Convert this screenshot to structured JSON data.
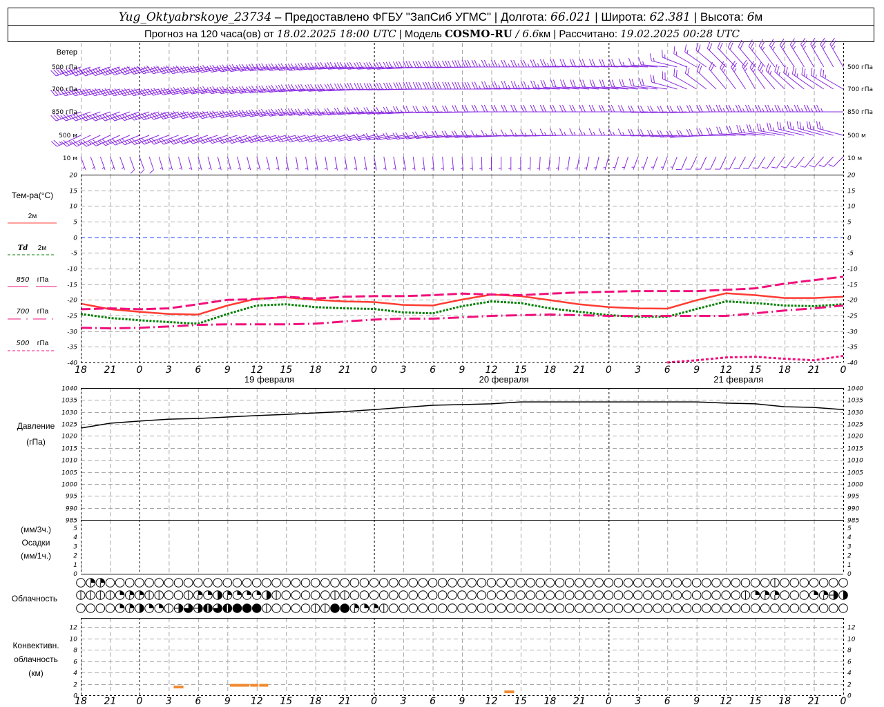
{
  "header": {
    "station": "Yug_Oktyabrskoye_23734",
    "provided": " – Предоставлено ФГБУ \"ЗапСиб УГМС\" | Долгота: ",
    "lon": "66.021",
    "lat_label": " | Широта: ",
    "lat": "62.381",
    "alt_label": " | Высота: ",
    "alt": "6",
    "alt_unit": "м",
    "forecast_label": "Прогноз на 120 часа(ов) от ",
    "forecast_time": "18.02.2025 18:00 UTC",
    "model_label": " | Модель ",
    "model": "COSMO-RU",
    "resolution": " / 6.6",
    "res_unit": "км",
    "calc_label": " | Рассчитано: ",
    "calc_time": "19.02.2025 00:28 UTC"
  },
  "labels": {
    "wind": "Ветер",
    "temp": "Тем-ра(°С)",
    "t2m": "2м",
    "td": "Td",
    "td2m": "2м",
    "l850": "850",
    "l700": "700",
    "l500": "500",
    "hpa": "гПа",
    "pressure": "Давление",
    "pressure_unit": "(гПа)",
    "precip3": "(мм/3ч.)",
    "precip": "Осадки",
    "precip1": "(мм/1ч.)",
    "clouds": "Облачность",
    "conv1": "Конвективн.",
    "conv2": "облачность",
    "conv3": "(км)"
  },
  "chart_data": {
    "type": "meteogram",
    "colors": {
      "wind": "#8a2be2",
      "t2m": "#ff3c32",
      "td2m": "#008000",
      "upper": "#f0107c",
      "zero_line": "#2040ff",
      "pressure": "#000000",
      "convective": "#f08a30"
    },
    "time_axis": {
      "times": [
        "18.02 18:00",
        "18.02 21:00",
        "19.02 00:00",
        "19.02 03:00",
        "19.02 06:00",
        "19.02 09:00",
        "19.02 12:00",
        "19.02 15:00",
        "19.02 18:00",
        "19.02 21:00",
        "20.02 00:00",
        "20.02 03:00",
        "20.02 06:00",
        "20.02 09:00",
        "20.02 12:00",
        "20.02 15:00",
        "20.02 18:00",
        "20.02 21:00",
        "21.02 00:00",
        "21.02 03:00",
        "21.02 06:00",
        "21.02 09:00",
        "21.02 12:00",
        "21.02 15:00",
        "21.02 18:00",
        "21.02 21:00",
        "22.02 00:00"
      ],
      "tick_labels": [
        "18",
        "21",
        "0",
        "3",
        "6",
        "9",
        "12",
        "15",
        "18",
        "21",
        "0",
        "3",
        "6",
        "9",
        "12",
        "15",
        "18",
        "21",
        "0",
        "3",
        "6",
        "9",
        "12",
        "15",
        "18",
        "21",
        "0"
      ],
      "day_labels": [
        "19 февраля",
        "20 февраля",
        "21 февраля"
      ]
    },
    "wind": {
      "levels": [
        {
          "label": "500 гПа",
          "dir": [
            250,
            250,
            252,
            255,
            255,
            258,
            260,
            262,
            262,
            265,
            265,
            265,
            268,
            268,
            270,
            270,
            270,
            272,
            272,
            272,
            275,
            300,
            315,
            320,
            325,
            330,
            330
          ],
          "speed": [
            40,
            40,
            40,
            38,
            38,
            36,
            36,
            35,
            35,
            35,
            32,
            30,
            30,
            28,
            28,
            25,
            25,
            22,
            20,
            18,
            15,
            15,
            20,
            22,
            25,
            25,
            25
          ]
        },
        {
          "label": "700 гПа",
          "dir": [
            255,
            255,
            255,
            255,
            258,
            260,
            260,
            262,
            265,
            265,
            268,
            268,
            270,
            270,
            270,
            272,
            272,
            275,
            275,
            275,
            278,
            300,
            320,
            330,
            315,
            305,
            300
          ],
          "speed": [
            35,
            35,
            35,
            35,
            32,
            32,
            30,
            30,
            30,
            28,
            28,
            28,
            30,
            30,
            28,
            25,
            25,
            20,
            18,
            18,
            20,
            20,
            22,
            25,
            25,
            25,
            25
          ]
        },
        {
          "label": "850 гПа",
          "dir": [
            250,
            250,
            250,
            252,
            255,
            255,
            258,
            260,
            262,
            262,
            265,
            265,
            268,
            268,
            270,
            270,
            270,
            270,
            270,
            270,
            268,
            268,
            270,
            270,
            270,
            270,
            270
          ],
          "speed": [
            30,
            30,
            30,
            30,
            30,
            28,
            28,
            28,
            28,
            25,
            25,
            25,
            22,
            22,
            20,
            20,
            18,
            18,
            18,
            20,
            20,
            20,
            22,
            25,
            25,
            25,
            25
          ]
        },
        {
          "label": "500 м",
          "dir": [
            245,
            245,
            248,
            250,
            250,
            252,
            252,
            255,
            255,
            255,
            258,
            260,
            262,
            265,
            265,
            268,
            268,
            270,
            270,
            270,
            268,
            265,
            270,
            275,
            280,
            285,
            285
          ],
          "speed": [
            25,
            25,
            25,
            25,
            25,
            25,
            25,
            22,
            22,
            22,
            20,
            20,
            18,
            18,
            18,
            15,
            15,
            15,
            15,
            15,
            20,
            20,
            20,
            22,
            25,
            25,
            25
          ]
        },
        {
          "label": "10 м",
          "dir": [
            160,
            160,
            160,
            165,
            165,
            165,
            165,
            170,
            170,
            170,
            170,
            170,
            175,
            175,
            180,
            180,
            185,
            190,
            195,
            200,
            200,
            205,
            205,
            210,
            215,
            220,
            225
          ],
          "speed": [
            5,
            5,
            10,
            5,
            5,
            5,
            5,
            5,
            5,
            5,
            5,
            5,
            5,
            5,
            5,
            5,
            5,
            5,
            5,
            5,
            5,
            10,
            10,
            10,
            10,
            10,
            10
          ]
        }
      ]
    },
    "temperature": {
      "ylim": [
        -40,
        20
      ],
      "yticks": [
        20,
        15,
        10,
        5,
        0,
        -5,
        -10,
        -15,
        -20,
        -25,
        -30,
        -35,
        -40
      ],
      "series": [
        {
          "name": "2м",
          "key": "t2m",
          "style": "solid",
          "values": [
            -21.2,
            -23,
            -23.8,
            -24.5,
            -24.7,
            -21.8,
            -19.6,
            -19.2,
            -20,
            -20.5,
            -20.7,
            -21.6,
            -21.8,
            -19.9,
            -18.3,
            -18.8,
            -20.1,
            -21.4,
            -22.3,
            -22.7,
            -22.8,
            -20.1,
            -17.9,
            -18.5,
            -19.4,
            -19.4,
            -19
          ]
        },
        {
          "name": "Td 2м",
          "key": "td2m",
          "style": "dotted",
          "values": [
            -24.5,
            -25.8,
            -26.5,
            -27.1,
            -27.6,
            -24.5,
            -21.8,
            -21.4,
            -22.3,
            -22.7,
            -22.9,
            -24,
            -24.3,
            -22,
            -20.5,
            -21,
            -22.7,
            -23.8,
            -24.9,
            -25.4,
            -25.4,
            -22.9,
            -20.5,
            -21,
            -21.8,
            -22,
            -21.4
          ]
        },
        {
          "name": "850 гПа",
          "key": "upper",
          "style": "longdash",
          "values": [
            -23,
            -22.7,
            -23,
            -22.7,
            -21.4,
            -20,
            -19.8,
            -19,
            -19.6,
            -19,
            -18.8,
            -18.8,
            -18.5,
            -18,
            -18.3,
            -18.5,
            -18,
            -17.6,
            -17.4,
            -17.2,
            -17.2,
            -17.2,
            -16.8,
            -16.3,
            -14.8,
            -13.7,
            -12.6
          ]
        },
        {
          "name": "700 гПа",
          "key": "upper",
          "style": "dashdot",
          "values": [
            -28.9,
            -29.1,
            -28.9,
            -28.5,
            -28,
            -27.8,
            -27.8,
            -27.8,
            -27.6,
            -26.9,
            -26.3,
            -26,
            -26,
            -25.6,
            -25.1,
            -24.9,
            -24.7,
            -24.9,
            -25.1,
            -25.1,
            -25.1,
            -25.1,
            -25.1,
            -24.3,
            -23.4,
            -22.7,
            -21.8
          ]
        },
        {
          "name": "500 гПа",
          "key": "upper",
          "style": "shortdash",
          "values": [
            null,
            null,
            null,
            null,
            null,
            null,
            null,
            null,
            null,
            null,
            null,
            null,
            null,
            null,
            null,
            null,
            null,
            null,
            null,
            null,
            -40,
            -39.3,
            -38.4,
            -38.2,
            -38.8,
            -39.3,
            -37.9
          ]
        }
      ]
    },
    "pressure": {
      "ylim": [
        985,
        1040
      ],
      "yticks": [
        1040,
        1035,
        1030,
        1025,
        1020,
        1015,
        1010,
        1005,
        1000,
        995,
        990,
        985
      ],
      "values": [
        1023.3,
        1025.3,
        1026.2,
        1027,
        1027.3,
        1027.9,
        1028.5,
        1029,
        1029.6,
        1030.2,
        1031,
        1031.9,
        1032.8,
        1033.1,
        1033.4,
        1034.2,
        1034.2,
        1034.2,
        1034.2,
        1034.2,
        1034.2,
        1034.2,
        1033.7,
        1033.4,
        1032.2,
        1031.9,
        1031
      ]
    },
    "precipitation": {
      "ylim": [
        0,
        5
      ],
      "yticks": [
        5,
        4,
        3,
        2,
        1,
        0
      ],
      "values": [
        0,
        0,
        0,
        0,
        0,
        0,
        0,
        0,
        0,
        0,
        0,
        0,
        0,
        0,
        0,
        0,
        0,
        0,
        0,
        0,
        0,
        0,
        0,
        0,
        0,
        0,
        0
      ]
    },
    "cloudiness": {
      "legend": "0 clear, 1 line, 2 quarter, 3 quarter+line, 4 half, 5 half+line, 6 three-quarter, 7 nearly full, 8 full",
      "rows": [
        [
          0,
          3,
          3,
          0,
          0,
          0,
          0,
          0,
          0,
          0,
          0,
          0,
          0,
          0,
          0,
          0,
          0,
          0,
          0,
          0,
          0,
          0,
          0,
          0,
          0,
          0,
          0,
          0,
          0,
          0,
          0,
          0,
          0,
          0,
          0,
          0,
          0,
          0,
          0,
          0,
          0,
          0,
          0,
          0,
          0,
          0,
          0,
          0,
          0,
          0,
          0,
          0,
          0,
          0,
          0,
          0,
          0,
          0,
          0,
          0,
          0,
          0,
          0,
          0,
          0,
          0,
          0,
          0,
          0,
          0,
          0,
          1,
          0,
          0,
          0,
          0,
          0,
          0,
          0
        ],
        [
          1,
          1,
          1,
          1,
          2,
          3,
          3,
          1,
          1,
          0,
          0,
          1,
          3,
          2,
          4,
          3,
          2,
          2,
          2,
          4,
          1,
          0,
          0,
          0,
          0,
          0,
          1,
          1,
          0,
          0,
          0,
          0,
          0,
          0,
          0,
          0,
          0,
          0,
          0,
          0,
          0,
          0,
          0,
          0,
          0,
          0,
          0,
          0,
          0,
          0,
          0,
          0,
          0,
          0,
          0,
          0,
          0,
          0,
          0,
          0,
          0,
          0,
          0,
          0,
          0,
          0,
          0,
          0,
          1,
          2,
          3,
          3,
          0,
          0,
          0,
          2,
          3,
          5,
          4
        ],
        [
          0,
          0,
          0,
          0,
          2,
          3,
          4,
          2,
          2,
          1,
          5,
          6,
          5,
          7,
          6,
          7,
          8,
          8,
          8,
          1,
          0,
          0,
          0,
          0,
          1,
          1,
          8,
          8,
          3,
          2,
          3,
          1,
          0,
          0,
          0,
          0,
          0,
          0,
          0,
          0,
          0,
          0,
          0,
          0,
          0,
          0,
          0,
          0,
          0,
          0,
          0,
          0,
          0,
          0,
          0,
          0,
          0,
          0,
          0,
          0,
          0,
          0,
          0,
          0,
          0,
          0,
          0,
          0,
          0,
          0,
          0,
          0,
          0,
          0,
          0,
          0,
          0,
          0,
          0
        ]
      ]
    },
    "convective": {
      "ylim": [
        0,
        13
      ],
      "yticks": [
        12,
        10,
        8,
        6,
        4,
        2,
        0
      ],
      "segments": [
        {
          "from": "19.02 03:30",
          "to": "19.02 04:30",
          "km": 1.45
        },
        {
          "from": "19.02 09:15",
          "to": "19.02 11:15",
          "km": 1.75
        },
        {
          "from": "19.02 11:20",
          "to": "19.02 12:10",
          "km": 1.75
        },
        {
          "from": "19.02 12:15",
          "to": "19.02 13:10",
          "km": 1.75
        },
        {
          "from": "20.02 13:20",
          "to": "20.02 14:20",
          "km": 0.6
        }
      ]
    }
  }
}
